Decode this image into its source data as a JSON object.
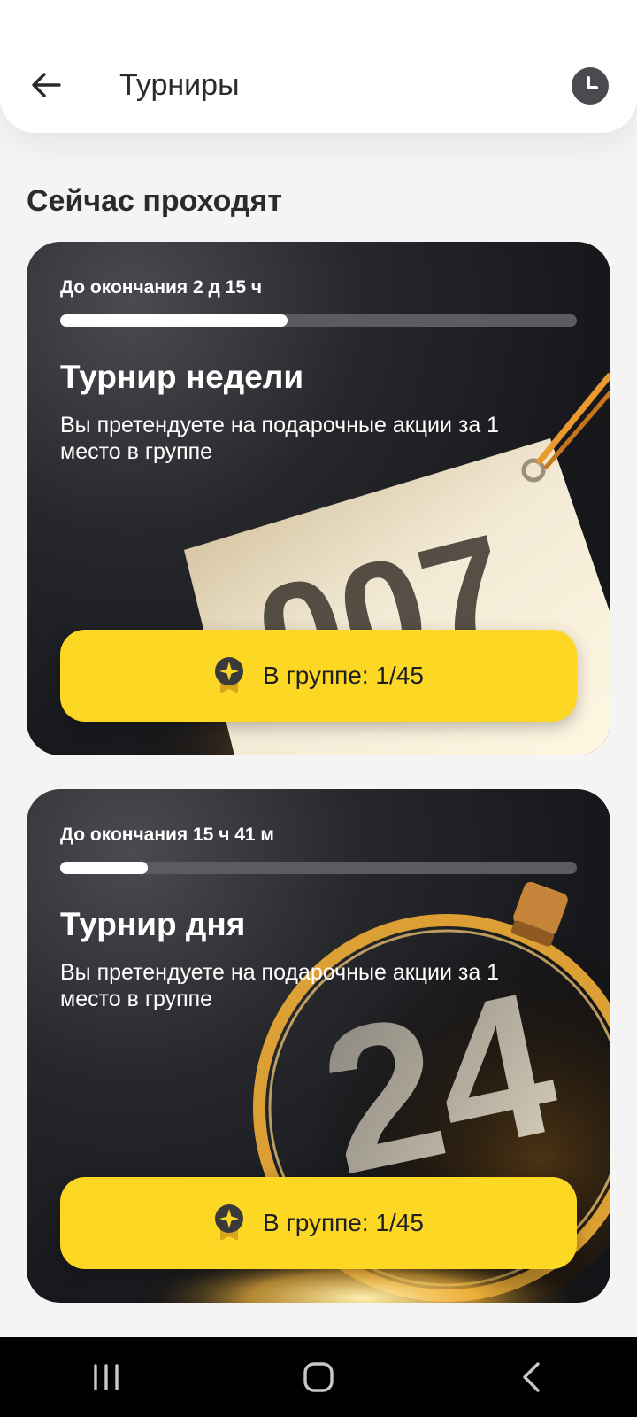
{
  "header": {
    "title": "Турниры",
    "back_icon": "arrow-left-icon",
    "history_icon": "clock-icon"
  },
  "section": {
    "title": "Сейчас проходят"
  },
  "tournaments": [
    {
      "countdown": "До окончания 2 д 15 ч",
      "progress": 0.44,
      "title": "Турнир недели",
      "description": "Вы претендуете на подарочные акции за 1 место в группе",
      "art_number": "007",
      "button_label": "В группе: 1/45",
      "button_icon": "medal-icon"
    },
    {
      "countdown": "До окончания 15 ч 41 м",
      "progress": 0.17,
      "title": "Турнир дня",
      "description": "Вы претендуете на подарочные акции за 1 место в группе",
      "art_number": "24",
      "button_label": "В группе: 1/45",
      "button_icon": "medal-icon"
    }
  ],
  "navbar": {
    "recent_icon": "recent-apps-icon",
    "home_icon": "home-icon",
    "back_icon": "back-icon"
  },
  "colors": {
    "accent": "#fcd824",
    "card_bg": "#1b1c1f",
    "gold": "#e6a735"
  }
}
